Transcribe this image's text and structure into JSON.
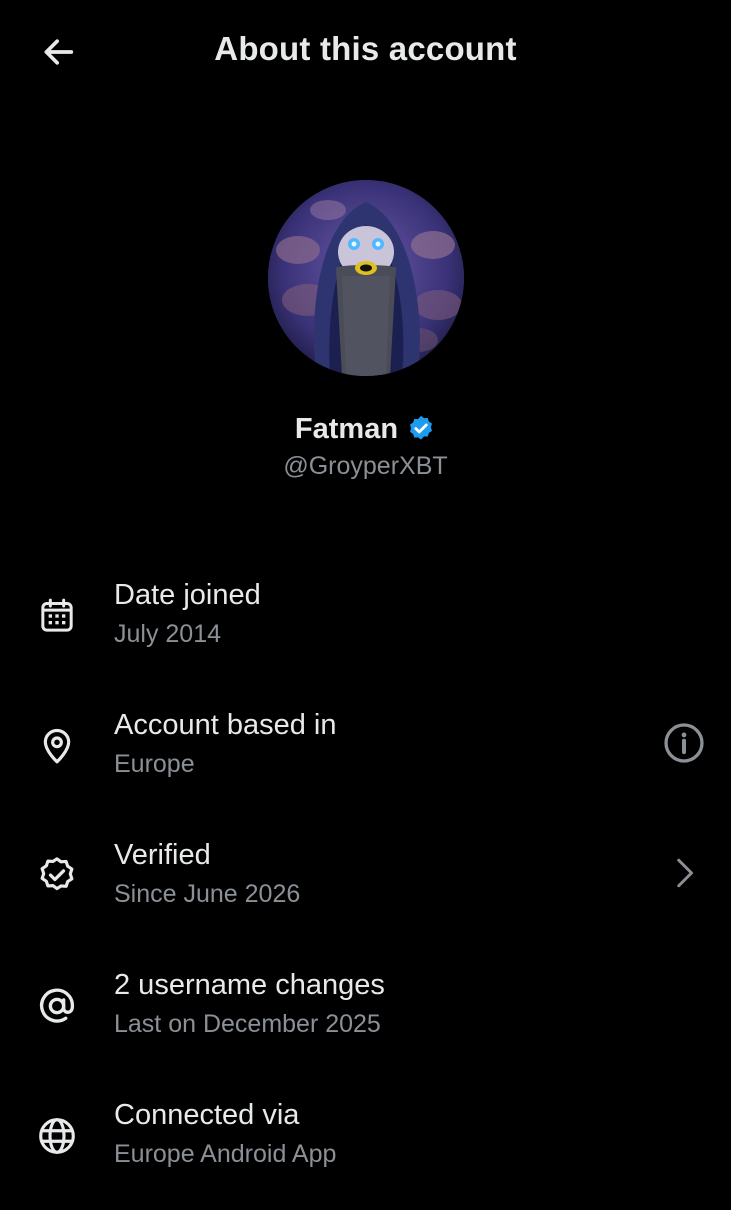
{
  "header": {
    "title": "About this account",
    "back_icon": "arrow-left-icon"
  },
  "profile": {
    "display_name": "Fatman",
    "handle": "@GroyperXBT",
    "verified_badge_icon": "verified-badge-icon",
    "verified_color": "#1d9bf0"
  },
  "info": [
    {
      "icon": "calendar-icon",
      "title": "Date joined",
      "subtitle": "July 2014"
    },
    {
      "icon": "location-pin-icon",
      "title": "Account based in",
      "subtitle": "Europe",
      "action_icon": "info-icon"
    },
    {
      "icon": "verified-check-icon",
      "title": "Verified",
      "subtitle": "Since June 2026",
      "action_icon": "chevron-right-icon"
    },
    {
      "icon": "at-sign-icon",
      "title": "2 username changes",
      "subtitle": "Last on December 2025"
    },
    {
      "icon": "globe-icon",
      "title": "Connected via",
      "subtitle": "Europe Android App"
    }
  ],
  "colors": {
    "background": "#000000",
    "text_primary": "#e7e9ea",
    "text_secondary": "#8b9096"
  }
}
